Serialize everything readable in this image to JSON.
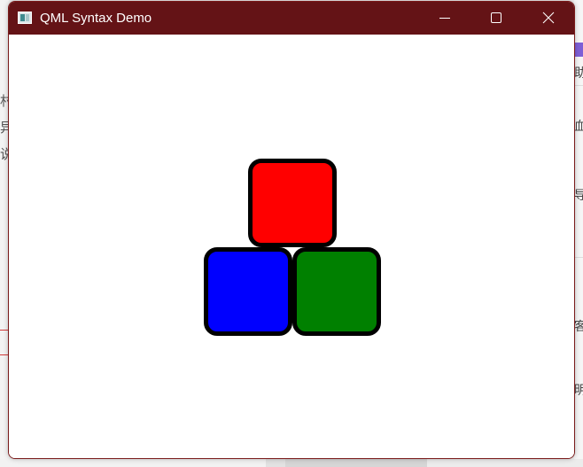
{
  "window": {
    "title": "QML Syntax Demo",
    "titlebar_color": "#641316",
    "icon": "window-app-icon",
    "controls": {
      "minimize_icon": "minimize-icon",
      "maximize_icon": "maximize-icon",
      "close_icon": "close-icon"
    }
  },
  "scene": {
    "rectangles": [
      {
        "name": "red-rectangle",
        "color": "#ff0000",
        "border_color": "#000000"
      },
      {
        "name": "blue-rectangle",
        "color": "#0000ff",
        "border_color": "#000000"
      },
      {
        "name": "green-rectangle",
        "color": "#008000",
        "border_color": "#000000"
      }
    ]
  },
  "background": {
    "left_glyphs": [
      "村",
      "异",
      "说"
    ],
    "right_glyphs": [
      "助",
      "血",
      "导",
      "客",
      "明"
    ]
  }
}
